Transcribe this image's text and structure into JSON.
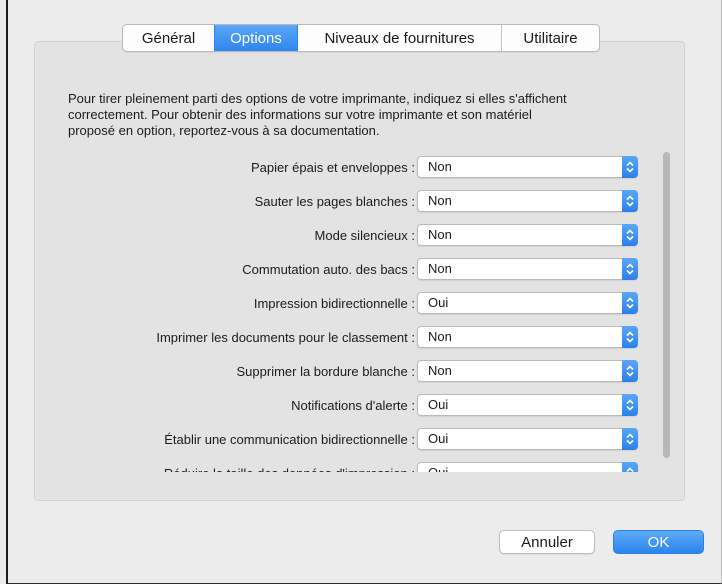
{
  "tabs": [
    {
      "label": "Général",
      "active": false
    },
    {
      "label": "Options",
      "active": true
    },
    {
      "label": "Niveaux de fournitures",
      "active": false
    },
    {
      "label": "Utilitaire",
      "active": false
    }
  ],
  "intro": {
    "line1": "Pour tirer pleinement parti des options de votre imprimante, indiquez si elles s'affichent",
    "line2": "correctement. Pour obtenir des informations sur votre imprimante et son matériel",
    "line3": "proposé en option, reportez-vous à sa documentation."
  },
  "options": [
    {
      "label": "Papier épais et enveloppes :",
      "value": "Non"
    },
    {
      "label": "Sauter les pages blanches :",
      "value": "Non"
    },
    {
      "label": "Mode silencieux :",
      "value": "Non"
    },
    {
      "label": "Commutation auto. des bacs :",
      "value": "Non"
    },
    {
      "label": "Impression bidirectionnelle :",
      "value": "Oui"
    },
    {
      "label": "Imprimer les documents pour le classement :",
      "value": "Non"
    },
    {
      "label": "Supprimer la bordure blanche :",
      "value": "Non"
    },
    {
      "label": "Notifications d'alerte :",
      "value": "Oui"
    },
    {
      "label": "Établir une communication bidirectionnelle :",
      "value": "Oui"
    },
    {
      "label": "Réduire la taille des données d'impression :",
      "value": "Oui"
    }
  ],
  "buttons": {
    "cancel": "Annuler",
    "ok": "OK"
  },
  "colors": {
    "accent": "#2e86ee",
    "window_bg": "#ececec",
    "panel_bg": "#e3e3e3"
  }
}
